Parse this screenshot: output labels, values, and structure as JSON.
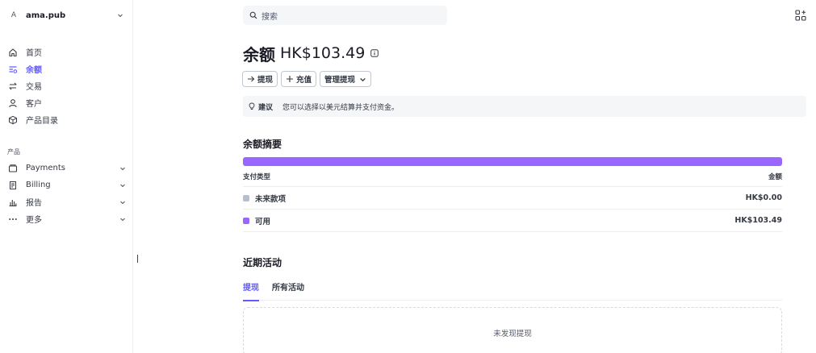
{
  "account": {
    "avatar_letter": "A",
    "name": "ama.pub"
  },
  "sidebar": {
    "items": [
      {
        "label": "首页",
        "icon": "home-icon"
      },
      {
        "label": "余额",
        "icon": "balance-icon",
        "active": true
      },
      {
        "label": "交易",
        "icon": "transactions-icon"
      },
      {
        "label": "客户",
        "icon": "customers-icon"
      },
      {
        "label": "产品目录",
        "icon": "product-catalog-icon"
      }
    ],
    "section_label": "产品",
    "product_items": [
      {
        "label": "Payments",
        "icon": "payments-icon"
      },
      {
        "label": "Billing",
        "icon": "billing-icon"
      },
      {
        "label": "报告",
        "icon": "reports-icon"
      },
      {
        "label": "更多",
        "icon": "more-icon"
      }
    ]
  },
  "search": {
    "placeholder": "搜索"
  },
  "header": {
    "title": "余额",
    "amount": "HK$103.49"
  },
  "actions": {
    "payout": "提现",
    "topup": "充值",
    "manage": "管理提现"
  },
  "tip": {
    "label": "建议",
    "text": "您可以选择以美元结算并支付资金。"
  },
  "summary": {
    "title": "余额摘要",
    "bar_color": "#9966ff",
    "col_type": "支付类型",
    "col_amount": "金额",
    "rows": [
      {
        "label": "未来款项",
        "amount": "HK$0.00",
        "color": "#b6c0cd"
      },
      {
        "label": "可用",
        "amount": "HK$103.49",
        "color": "#9966ff"
      }
    ]
  },
  "activity": {
    "title": "近期活动",
    "tabs": [
      "提现",
      "所有活动"
    ],
    "empty": "未发现提现"
  }
}
